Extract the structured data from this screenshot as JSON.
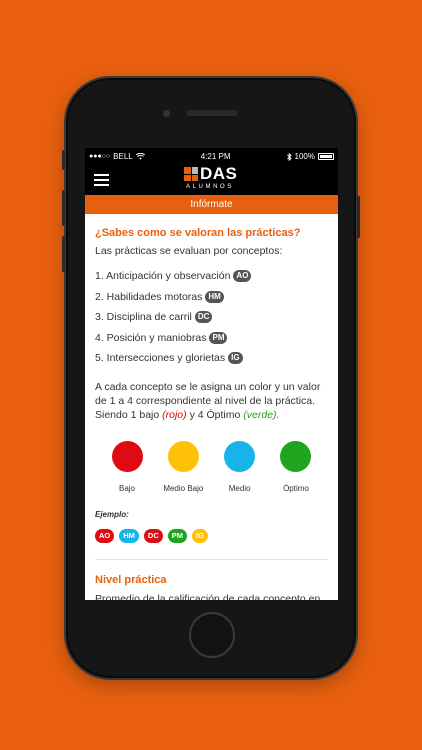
{
  "status": {
    "carrier": "BELL",
    "time": "4:21 PM",
    "battery": "100%"
  },
  "header": {
    "logo": "DAS",
    "logo_sub": "ALUMNOS"
  },
  "tab": {
    "label": "Infórmate"
  },
  "section": {
    "title": "¿Sabes como se valoran las prácticas?",
    "intro": "Las prácticas se evaluan por conceptos:",
    "concepts": [
      {
        "text": "1. Anticipación y observación",
        "code": "AO"
      },
      {
        "text": "2. Habilidades motoras",
        "code": "HM"
      },
      {
        "text": "3. Disciplina de carril",
        "code": "DC"
      },
      {
        "text": "4. Posición y maniobras",
        "code": "PM"
      },
      {
        "text": "5. Intersecciones y glorietas",
        "code": "IG"
      }
    ],
    "desc_a": "A cada concepto se le asigna un color y un valor de 1 a 4 correspondiente al nivel de la práctica. Siendo 1 bajo ",
    "desc_rojo": "(rojo)",
    "desc_b": " y 4 Óptimo ",
    "desc_verde": "(verde)."
  },
  "legend": [
    {
      "label": "Bajo",
      "color": "#e00a12"
    },
    {
      "label": "Medio Bajo",
      "color": "#ffc107"
    },
    {
      "label": "Medio",
      "color": "#17b4ea"
    },
    {
      "label": "Óptimo",
      "color": "#1fa41f"
    }
  ],
  "example": {
    "label": "Ejemplo:",
    "items": [
      {
        "code": "AO",
        "color": "#e00a12"
      },
      {
        "code": "HM",
        "color": "#17b4ea"
      },
      {
        "code": "DC",
        "color": "#e00a12"
      },
      {
        "code": "PM",
        "color": "#1fa41f"
      },
      {
        "code": "IG",
        "color": "#ffc107"
      }
    ]
  },
  "nivel": {
    "title": "Nivel práctica",
    "desc": "Promedio de la calificación de cada concepto en"
  }
}
